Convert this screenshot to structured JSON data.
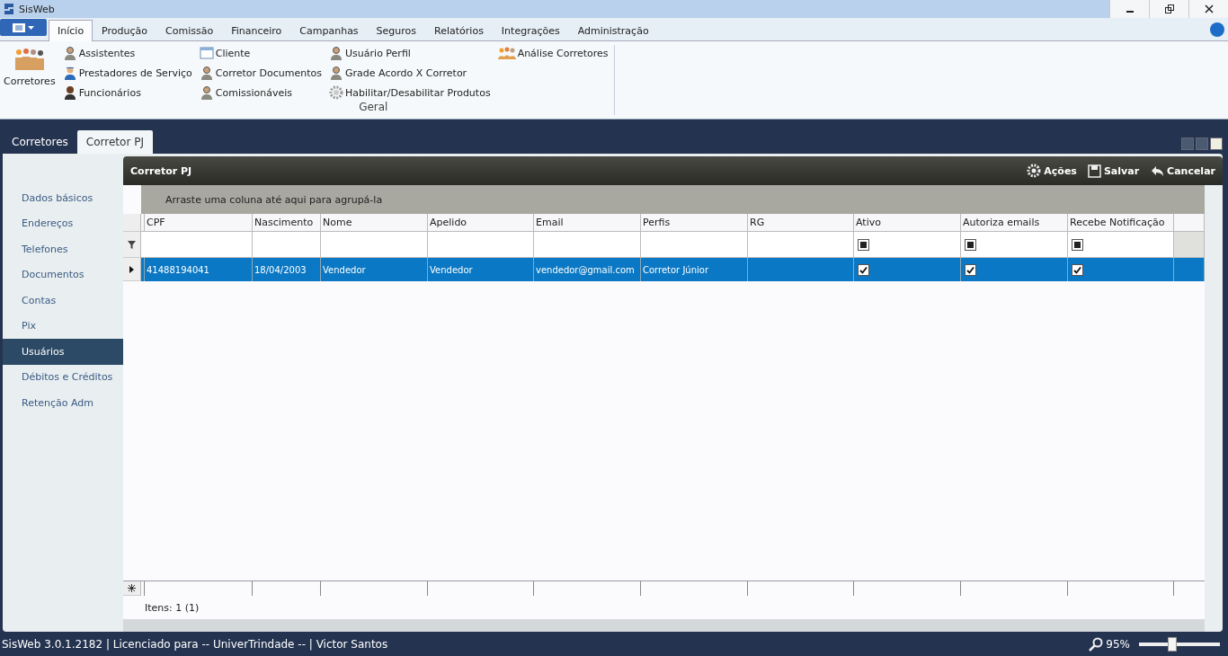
{
  "window": {
    "title": "SisWeb"
  },
  "menu_tabs": [
    {
      "label": "Início",
      "selected": true
    },
    {
      "label": "Produção",
      "selected": false
    },
    {
      "label": "Comissão",
      "selected": false
    },
    {
      "label": "Financeiro",
      "selected": false
    },
    {
      "label": "Campanhas",
      "selected": false
    },
    {
      "label": "Seguros",
      "selected": false
    },
    {
      "label": "Relatórios",
      "selected": false
    },
    {
      "label": "Integrações",
      "selected": false
    },
    {
      "label": "Administração",
      "selected": false
    }
  ],
  "ribbon": {
    "large_button": {
      "label": "Corretores"
    },
    "columns": [
      [
        {
          "label": "Assistentes",
          "kind": "person"
        },
        {
          "label": "Prestadores de Serviço",
          "kind": "worker"
        },
        {
          "label": "Funcionários",
          "kind": "woman"
        }
      ],
      [
        {
          "label": "Cliente",
          "kind": "window"
        },
        {
          "label": "Corretor Documentos",
          "kind": "person"
        },
        {
          "label": "Comissionáveis",
          "kind": "person"
        }
      ],
      [
        {
          "label": "Usuário Perfil",
          "kind": "person"
        },
        {
          "label": "Grade Acordo X Corretor",
          "kind": "person"
        },
        {
          "label": "Habilitar/Desabilitar Produtos",
          "kind": "gear"
        }
      ],
      [
        {
          "label": "Análise Corretores",
          "kind": "group"
        }
      ]
    ],
    "group_label": "Geral"
  },
  "doc_tabs": [
    {
      "label": "Corretores",
      "selected": false
    },
    {
      "label": "Corretor PJ",
      "selected": true
    }
  ],
  "sidebar": {
    "items": [
      {
        "label": "Dados básicos",
        "selected": false
      },
      {
        "label": "Endereços",
        "selected": false
      },
      {
        "label": "Telefones",
        "selected": false
      },
      {
        "label": "Documentos",
        "selected": false
      },
      {
        "label": "Contas",
        "selected": false
      },
      {
        "label": "Pix",
        "selected": false
      },
      {
        "label": "Usuários",
        "selected": true
      },
      {
        "label": "Débitos e Créditos",
        "selected": false
      },
      {
        "label": "Retenção Adm",
        "selected": false
      }
    ]
  },
  "panel": {
    "title": "Corretor PJ",
    "actions": [
      {
        "label": "Ações",
        "kind": "gear"
      },
      {
        "label": "Salvar",
        "kind": "save"
      },
      {
        "label": "Cancelar",
        "kind": "undo"
      }
    ]
  },
  "grid": {
    "group_hint": "Arraste uma coluna até aqui para agrupá-la",
    "columns": [
      {
        "label": "CPF",
        "kind": "text"
      },
      {
        "label": "Nascimento",
        "kind": "text"
      },
      {
        "label": "Nome",
        "kind": "text"
      },
      {
        "label": "Apelido",
        "kind": "text"
      },
      {
        "label": "Email",
        "kind": "text"
      },
      {
        "label": "Perfis",
        "kind": "text"
      },
      {
        "label": "RG",
        "kind": "text"
      },
      {
        "label": "Ativo",
        "kind": "bool"
      },
      {
        "label": "Autoriza emails",
        "kind": "bool"
      },
      {
        "label": "Recebe Notificação",
        "kind": "bool"
      }
    ],
    "filter_indeterminate": true,
    "rows": [
      {
        "selected": true,
        "cells": [
          "41488194041",
          "18/04/2003",
          "Vendedor",
          "Vendedor",
          "vendedor@gmail.com",
          "Corretor Júnior",
          "",
          true,
          true,
          true
        ]
      }
    ],
    "footer": "Itens: 1 (1)"
  },
  "status_bar": {
    "text": "SisWeb 3.0.1.2182 | Licenciado para -- UniverTrindade -- | Victor Santos",
    "zoom": "95%",
    "zoom_slider": {
      "level": 0.4
    }
  }
}
